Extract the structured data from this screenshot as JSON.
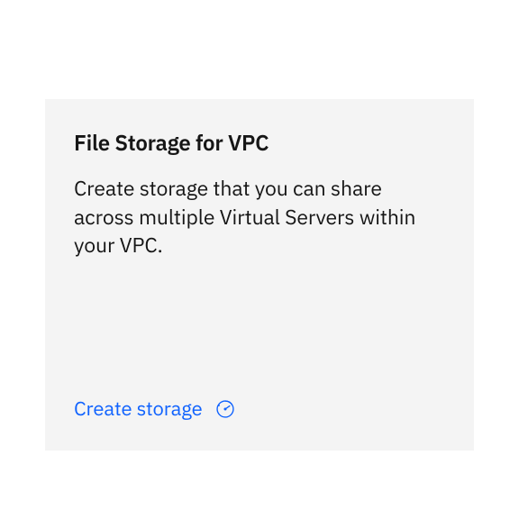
{
  "card": {
    "title": "File Storage for VPC",
    "description": "Create storage that you can share across multiple Virtual Servers within your VPC.",
    "link_label": "Create storage"
  },
  "colors": {
    "link": "#0f62fe",
    "text": "#161616",
    "card_bg": "#f4f4f4"
  }
}
